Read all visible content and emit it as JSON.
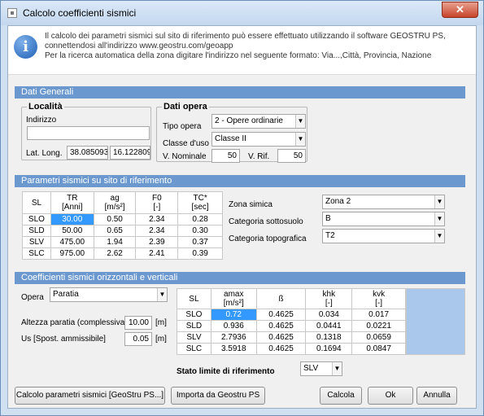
{
  "window": {
    "title": "Calcolo coefficienti sismici",
    "close": "✕"
  },
  "info": {
    "lines": [
      "Il calcolo dei parametri sismici sul sito di riferimento può essere effettuato utilizzando il software GEOSTRU PS,",
      "connettendosi all'indirizzo www.geostru.com/geoapp",
      "Per la ricerca automatica della zona digitare l'indirizzo nel seguente formato: Via...,Città, Provincia, Nazione"
    ]
  },
  "dati_generali": {
    "header": "Dati Generali",
    "localita": {
      "title": "Località",
      "indirizzo_label": "Indirizzo",
      "indirizzo_value": "",
      "latlong_label": "Lat. Long.",
      "lat": "38.085093",
      "long": "16.122809"
    },
    "dati_opera": {
      "title": "Dati opera",
      "tipo_opera_label": "Tipo opera",
      "tipo_opera_value": "2 - Opere ordinarie",
      "classe_uso_label": "Classe d'uso",
      "classe_uso_value": "Classe II",
      "v_nominale_label": "V. Nominale",
      "v_nominale_value": "50",
      "v_rif_label": "V. Rif.",
      "v_rif_value": "50"
    }
  },
  "parametri": {
    "header": "Parametri sismici su sito di riferimento",
    "columns": [
      {
        "l1": "SL",
        "l2": ""
      },
      {
        "l1": "TR",
        "l2": "[Anni]"
      },
      {
        "l1": "ag",
        "l2": "[m/s²]"
      },
      {
        "l1": "F0",
        "l2": "[-]"
      },
      {
        "l1": "TC*",
        "l2": "[sec]"
      }
    ],
    "rows": [
      [
        "SLO",
        "30.00",
        "0.50",
        "2.34",
        "0.28"
      ],
      [
        "SLD",
        "50.00",
        "0.65",
        "2.34",
        "0.30"
      ],
      [
        "SLV",
        "475.00",
        "1.94",
        "2.39",
        "0.37"
      ],
      [
        "SLC",
        "975.00",
        "2.62",
        "2.41",
        "0.39"
      ]
    ],
    "zona_label": "Zona simica",
    "zona_value": "Zona 2",
    "sottosuolo_label": "Categoria sottosuolo",
    "sottosuolo_value": "B",
    "topografica_label": "Categoria topografica",
    "topografica_value": "T2"
  },
  "coefficienti": {
    "header": "Coefficienti sismici orizzontali e verticali",
    "opera_label": "Opera",
    "opera_value": "Paratia",
    "altezza_label": "Altezza paratia (complessiva)",
    "altezza_value": "10.00",
    "altezza_unit": "[m]",
    "us_label": "Us [Spost. ammissibile]",
    "us_value": "0.05",
    "us_unit": "[m]",
    "columns": [
      {
        "l1": "SL",
        "l2": ""
      },
      {
        "l1": "amax",
        "l2": "[m/s²]"
      },
      {
        "l1": "ß",
        "l2": ""
      },
      {
        "l1": "khk",
        "l2": "[-]"
      },
      {
        "l1": "kvk",
        "l2": "[-]"
      }
    ],
    "rows": [
      [
        "SLO",
        "0.72",
        "0.4625",
        "0.034",
        "0.017"
      ],
      [
        "SLD",
        "0.936",
        "0.4625",
        "0.0441",
        "0.0221"
      ],
      [
        "SLV",
        "2.7936",
        "0.4625",
        "0.1318",
        "0.0659"
      ],
      [
        "SLC",
        "3.5918",
        "0.4625",
        "0.1694",
        "0.0847"
      ]
    ],
    "stato_label": "Stato limite di riferimento",
    "stato_value": "SLV"
  },
  "buttons": {
    "calcolo_geostru": "Calcolo parametri sismici [GeoStru PS...]",
    "importa": "Importa da Geostru PS",
    "calcola": "Calcola",
    "ok": "Ok",
    "annulla": "Annulla"
  },
  "colors": {
    "section_header": "#6b99cf",
    "selection": "#3399ff",
    "info_icon": "#1d5fb5"
  }
}
